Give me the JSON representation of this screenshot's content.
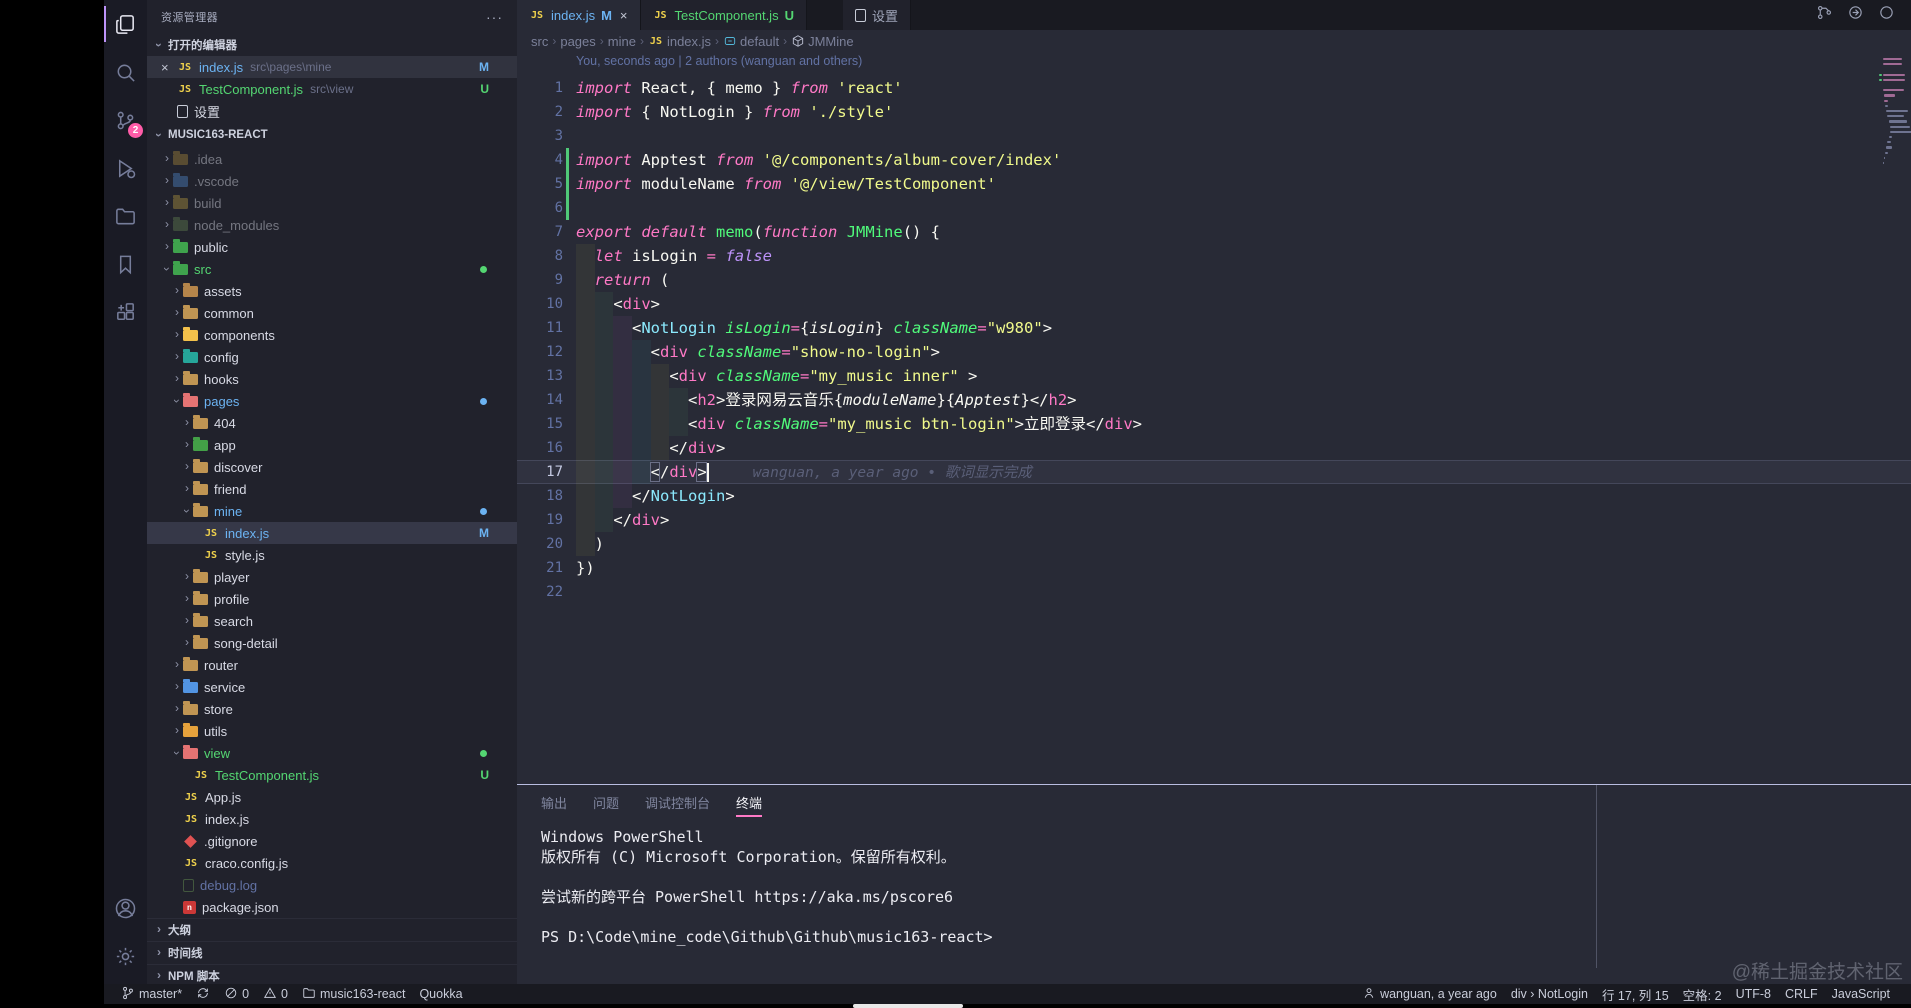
{
  "colors": {
    "accent": "#ff79c6",
    "modified": "#6cb3f2",
    "untracked": "#54d672",
    "added_line": "#50c878"
  },
  "activity_bar": {
    "items": [
      {
        "icon": "files-icon",
        "active": true
      },
      {
        "icon": "search-icon"
      },
      {
        "icon": "source-control-icon",
        "badge": "2"
      },
      {
        "icon": "run-debug-icon"
      },
      {
        "icon": "folder-explorer-icon"
      },
      {
        "icon": "bookmark-icon"
      },
      {
        "icon": "extensions-icon"
      }
    ],
    "bottom": [
      {
        "icon": "account-icon"
      },
      {
        "icon": "settings-gear-icon"
      }
    ]
  },
  "sidebar": {
    "title": "资源管理器",
    "more": "···",
    "open_editors_header": "打开的编辑器",
    "open_editors": [
      {
        "close": "×",
        "icon": "js",
        "label": "index.js",
        "detail": "src\\pages\\mine",
        "badge": "M",
        "color": "mod",
        "selected": true
      },
      {
        "close": "",
        "icon": "js",
        "label": "TestComponent.js",
        "detail": "src\\view",
        "badge": "U",
        "color": "untracked"
      },
      {
        "close": "",
        "icon": "doc",
        "label": "设置",
        "detail": "",
        "badge": "",
        "color": ""
      }
    ],
    "project_header": "MUSIC163-REACT",
    "tree": [
      {
        "indent": 1,
        "kind": "folder",
        "state": "collapsed",
        "label": ".idea",
        "icon_color": "#9e7f3a",
        "dim": true
      },
      {
        "indent": 1,
        "kind": "folder",
        "state": "collapsed",
        "label": ".vscode",
        "icon_color": "#4d7fbe",
        "dim": true
      },
      {
        "indent": 1,
        "kind": "folder",
        "state": "collapsed",
        "label": "build",
        "icon_color": "#a98f3e",
        "dim": true
      },
      {
        "indent": 1,
        "kind": "folder",
        "state": "collapsed",
        "label": "node_modules",
        "icon_color": "#5e7a4e",
        "dim": true
      },
      {
        "indent": 1,
        "kind": "folder",
        "state": "collapsed",
        "label": "public",
        "icon_color": "#3fa34d"
      },
      {
        "indent": 1,
        "kind": "folder",
        "state": "expanded",
        "label": "src",
        "icon_color": "#3fa34d",
        "label_class": "untracked",
        "dot": "#54d672"
      },
      {
        "indent": 2,
        "kind": "folder",
        "state": "collapsed",
        "label": "assets",
        "icon_color": "#b5854a"
      },
      {
        "indent": 2,
        "kind": "folder",
        "state": "collapsed",
        "label": "common",
        "icon_color": "#c09553"
      },
      {
        "indent": 2,
        "kind": "folder",
        "state": "collapsed",
        "label": "components",
        "icon_color": "#f3c14b"
      },
      {
        "indent": 2,
        "kind": "folder",
        "state": "collapsed",
        "label": "config",
        "icon_color": "#26a69a"
      },
      {
        "indent": 2,
        "kind": "folder",
        "state": "collapsed",
        "label": "hooks",
        "icon_color": "#c09553"
      },
      {
        "indent": 2,
        "kind": "folder",
        "state": "expanded",
        "label": "pages",
        "icon_color": "#e57373",
        "label_class": "mod",
        "dot": "#6cb3f2"
      },
      {
        "indent": 3,
        "kind": "folder",
        "state": "collapsed",
        "label": "404",
        "icon_color": "#c09553"
      },
      {
        "indent": 3,
        "kind": "folder",
        "state": "collapsed",
        "label": "app",
        "icon_color": "#43a047"
      },
      {
        "indent": 3,
        "kind": "folder",
        "state": "collapsed",
        "label": "discover",
        "icon_color": "#c09553"
      },
      {
        "indent": 3,
        "kind": "folder",
        "state": "collapsed",
        "label": "friend",
        "icon_color": "#c09553"
      },
      {
        "indent": 3,
        "kind": "folder",
        "state": "expanded",
        "label": "mine",
        "icon_color": "#c09553",
        "label_class": "mod",
        "dot": "#6cb3f2"
      },
      {
        "indent": 4,
        "kind": "file",
        "icon": "js",
        "label": "index.js",
        "label_class": "mod",
        "badge": "M",
        "selected": true
      },
      {
        "indent": 4,
        "kind": "file",
        "icon": "js",
        "label": "style.js"
      },
      {
        "indent": 3,
        "kind": "folder",
        "state": "collapsed",
        "label": "player",
        "icon_color": "#c09553"
      },
      {
        "indent": 3,
        "kind": "folder",
        "state": "collapsed",
        "label": "profile",
        "icon_color": "#c09553"
      },
      {
        "indent": 3,
        "kind": "folder",
        "state": "collapsed",
        "label": "search",
        "icon_color": "#c09553"
      },
      {
        "indent": 3,
        "kind": "folder",
        "state": "collapsed",
        "label": "song-detail",
        "icon_color": "#c09553"
      },
      {
        "indent": 2,
        "kind": "folder",
        "state": "collapsed",
        "label": "router",
        "icon_color": "#c09553"
      },
      {
        "indent": 2,
        "kind": "folder",
        "state": "collapsed",
        "label": "service",
        "icon_color": "#5294e2"
      },
      {
        "indent": 2,
        "kind": "folder",
        "state": "collapsed",
        "label": "store",
        "icon_color": "#c09553"
      },
      {
        "indent": 2,
        "kind": "folder",
        "state": "collapsed",
        "label": "utils",
        "icon_color": "#e6a23c"
      },
      {
        "indent": 2,
        "kind": "folder",
        "state": "expanded",
        "label": "view",
        "icon_color": "#e57373",
        "label_class": "untracked",
        "dot": "#54d672"
      },
      {
        "indent": 3,
        "kind": "file",
        "icon": "js",
        "label": "TestComponent.js",
        "label_class": "untracked",
        "badge": "U"
      },
      {
        "indent": 2,
        "kind": "file",
        "icon": "js",
        "label": "App.js"
      },
      {
        "indent": 2,
        "kind": "file",
        "icon": "js",
        "label": "index.js"
      },
      {
        "indent": 2,
        "kind": "file",
        "icon": "diamond",
        "label": ".gitignore"
      },
      {
        "indent": 2,
        "kind": "file",
        "icon": "js",
        "label": "craco.config.js"
      },
      {
        "indent": 2,
        "kind": "file",
        "icon": "log",
        "label": "debug.log",
        "label_class": "gitignored",
        "dim": true
      },
      {
        "indent": 2,
        "kind": "file",
        "icon": "npm",
        "label": "package.json"
      }
    ],
    "bottom_sections": [
      "大纲",
      "时间线",
      "NPM 脚本"
    ]
  },
  "editor": {
    "tabs": [
      {
        "icon": "js",
        "label": "index.js",
        "label_class": "mod",
        "badge": "M",
        "badge_class": "mod",
        "close": "×",
        "active": true
      },
      {
        "icon": "js",
        "label": "TestComponent.js",
        "label_class": "untracked",
        "badge": "U",
        "badge_class": "untracked"
      },
      {
        "icon": "doc",
        "label": "设置",
        "gap": true
      }
    ],
    "actions": [
      "source-control-graph-icon",
      "open-changes-icon",
      "preview-circle-icon"
    ],
    "breadcrumbs": [
      {
        "label": "src"
      },
      {
        "label": "pages"
      },
      {
        "label": "mine"
      },
      {
        "label": "index.js",
        "icon": "js"
      },
      {
        "label": "default",
        "icon": "symbol"
      },
      {
        "label": "JMMine",
        "icon": "cube"
      }
    ],
    "codelens": "You, seconds ago | 2 authors (wanguan and others)",
    "blame": "wanguan, a year ago • 歌词显示完成",
    "lines": [
      {
        "n": 1,
        "tokens": [
          [
            "kw",
            "import"
          ],
          [
            "fg",
            " React, { memo } "
          ],
          [
            "kw",
            "from"
          ],
          [
            "str",
            " 'react'"
          ]
        ]
      },
      {
        "n": 2,
        "tokens": [
          [
            "kw",
            "import"
          ],
          [
            "fg",
            " { NotLogin } "
          ],
          [
            "kw",
            "from"
          ],
          [
            "str",
            " './style'"
          ]
        ]
      },
      {
        "n": 3,
        "tokens": []
      },
      {
        "n": 4,
        "added": true,
        "tokens": [
          [
            "kw",
            "import"
          ],
          [
            "fg",
            " Apptest "
          ],
          [
            "kw",
            "from"
          ],
          [
            "str",
            " '@/components/album-cover/index'"
          ]
        ]
      },
      {
        "n": 5,
        "added": true,
        "tokens": [
          [
            "kw",
            "import"
          ],
          [
            "fg",
            " moduleName "
          ],
          [
            "kw",
            "from"
          ],
          [
            "str",
            " '@/view/TestComponent'"
          ]
        ]
      },
      {
        "n": 6,
        "added": true,
        "tokens": []
      },
      {
        "n": 7,
        "tokens": [
          [
            "kw",
            "export"
          ],
          [
            "fg",
            " "
          ],
          [
            "kw",
            "default"
          ],
          [
            "fg",
            " "
          ],
          [
            "grn",
            "memo"
          ],
          [
            "fg",
            "("
          ],
          [
            "kw",
            "function"
          ],
          [
            "fg",
            " "
          ],
          [
            "grn",
            "JMMine"
          ],
          [
            "fg",
            "() {"
          ]
        ]
      },
      {
        "n": 8,
        "tokens": [
          [
            "fg",
            "  "
          ],
          [
            "kw",
            "let"
          ],
          [
            "fg",
            " isLogin "
          ],
          [
            "pnk",
            "="
          ],
          [
            "fg",
            " "
          ],
          [
            "pur",
            "false"
          ]
        ]
      },
      {
        "n": 9,
        "tokens": [
          [
            "fg",
            "  "
          ],
          [
            "kw",
            "return"
          ],
          [
            "fg",
            " ("
          ]
        ]
      },
      {
        "n": 10,
        "tokens": [
          [
            "fg",
            "    <"
          ],
          [
            "tag",
            "div"
          ],
          [
            "fg",
            ">"
          ]
        ]
      },
      {
        "n": 11,
        "tokens": [
          [
            "fg",
            "      <"
          ],
          [
            "cyan",
            "NotLogin"
          ],
          [
            "fg",
            " "
          ],
          [
            "grnI",
            "isLogin"
          ],
          [
            "pnk",
            "="
          ],
          [
            "fg",
            "{"
          ],
          [
            "fgI",
            "isLogin"
          ],
          [
            "fg",
            "} "
          ],
          [
            "grnI",
            "className"
          ],
          [
            "pnk",
            "="
          ],
          [
            "str",
            "\"w980\""
          ],
          [
            "fg",
            ">"
          ]
        ]
      },
      {
        "n": 12,
        "tokens": [
          [
            "fg",
            "        <"
          ],
          [
            "tag",
            "div"
          ],
          [
            "fg",
            " "
          ],
          [
            "grnI",
            "className"
          ],
          [
            "pnk",
            "="
          ],
          [
            "str",
            "\"show-no-login\""
          ],
          [
            "fg",
            ">"
          ]
        ]
      },
      {
        "n": 13,
        "tokens": [
          [
            "fg",
            "          <"
          ],
          [
            "tag",
            "div"
          ],
          [
            "fg",
            " "
          ],
          [
            "grnI",
            "className"
          ],
          [
            "pnk",
            "="
          ],
          [
            "str",
            "\"my_music inner\""
          ],
          [
            "fg",
            " >"
          ]
        ]
      },
      {
        "n": 14,
        "tokens": [
          [
            "fg",
            "            <"
          ],
          [
            "tag",
            "h2"
          ],
          [
            "fg",
            ">登录网易云音乐{"
          ],
          [
            "fgI",
            "moduleName"
          ],
          [
            "fg",
            "}{"
          ],
          [
            "fgI",
            "Apptest"
          ],
          [
            "fg",
            "}</"
          ],
          [
            "tag",
            "h2"
          ],
          [
            "fg",
            ">"
          ]
        ]
      },
      {
        "n": 15,
        "tokens": [
          [
            "fg",
            "            <"
          ],
          [
            "tag",
            "div"
          ],
          [
            "fg",
            " "
          ],
          [
            "grnI",
            "className"
          ],
          [
            "pnk",
            "="
          ],
          [
            "str",
            "\"my_music btn-login\""
          ],
          [
            "fg",
            ">立即登录</"
          ],
          [
            "tag",
            "div"
          ],
          [
            "fg",
            ">"
          ]
        ]
      },
      {
        "n": 16,
        "tokens": [
          [
            "fg",
            "          </"
          ],
          [
            "tag",
            "div"
          ],
          [
            "fg",
            ">"
          ]
        ]
      },
      {
        "n": 17,
        "current": true,
        "cursor_ch": 14,
        "bracket_boxes": [
          8,
          13
        ],
        "show_blame": true,
        "tokens": [
          [
            "fg",
            "        </"
          ],
          [
            "tag",
            "div"
          ],
          [
            "fg",
            ">"
          ]
        ]
      },
      {
        "n": 18,
        "tokens": [
          [
            "fg",
            "      </"
          ],
          [
            "cyan",
            "NotLogin"
          ],
          [
            "fg",
            ">"
          ]
        ]
      },
      {
        "n": 19,
        "tokens": [
          [
            "fg",
            "    </"
          ],
          [
            "tag",
            "div"
          ],
          [
            "fg",
            ">"
          ]
        ]
      },
      {
        "n": 20,
        "tokens": [
          [
            "fg",
            "  )"
          ]
        ]
      },
      {
        "n": 21,
        "tokens": [
          [
            "fg",
            "})"
          ]
        ]
      },
      {
        "n": 22,
        "tokens": []
      }
    ]
  },
  "panel": {
    "tabs": [
      {
        "label": "输出"
      },
      {
        "label": "问题"
      },
      {
        "label": "调试控制台"
      },
      {
        "label": "终端",
        "active": true
      }
    ],
    "terminal_lines": [
      "Windows PowerShell",
      "版权所有 (C) Microsoft Corporation。保留所有权利。",
      "",
      "尝试新的跨平台 PowerShell https://aka.ms/pscore6",
      "",
      "PS D:\\Code\\mine_code\\Github\\Github\\music163-react>"
    ]
  },
  "status_bar": {
    "left": [
      {
        "icon": "git-branch-icon",
        "label": "master*"
      },
      {
        "icon": "sync-icon",
        "label": ""
      },
      {
        "icon": "error-icon",
        "label": "0"
      },
      {
        "icon": "warning-icon",
        "label": "0"
      },
      {
        "icon": "folder-icon",
        "label": "music163-react"
      },
      {
        "label": "Quokka"
      }
    ],
    "right": [
      {
        "icon": "person-icon",
        "label": "wanguan, a year ago"
      },
      {
        "label": "div › NotLogin"
      },
      {
        "label": "行 17, 列 15"
      },
      {
        "label": "空格: 2"
      },
      {
        "label": "UTF-8"
      },
      {
        "label": "CRLF"
      },
      {
        "label": "JavaScript"
      }
    ]
  },
  "watermark": "@稀土掘金技术社区"
}
